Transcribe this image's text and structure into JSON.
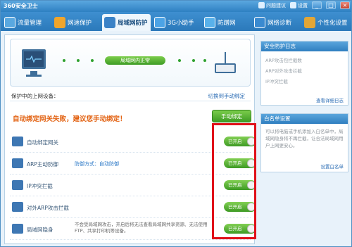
{
  "window": {
    "title": "360安全卫士",
    "feedback": "问题建议",
    "settings": "设置",
    "buttons": [
      "_",
      "□",
      "×"
    ]
  },
  "tabs": [
    {
      "label": "流量管理",
      "icon": "bar-chart-icon",
      "color": "#5aa8e0"
    },
    {
      "label": "网速保护",
      "icon": "speed-icon",
      "color": "#f0a52c"
    },
    {
      "label": "局域网防护",
      "icon": "lan-shield-icon",
      "color": "#3b82c6",
      "active": true
    },
    {
      "label": "3G小助手",
      "icon": "3g-icon",
      "color": "#4ca3e5"
    },
    {
      "label": "防蹭网",
      "icon": "wifi-icon",
      "color": "#59b1ea"
    },
    {
      "label": "网络诊断",
      "icon": "diagnose-icon",
      "color": "#3a8ad0"
    },
    {
      "label": "个性化设置",
      "icon": "puzzle-icon",
      "color": "#e2a637"
    }
  ],
  "status": {
    "text": "局域网内正常",
    "protection_label": "保护中的上网设备：",
    "protection_link": "切换到手动绑定"
  },
  "bind": {
    "warning": "自动绑定网关失败，建议您手动绑定！",
    "button": "手动绑定"
  },
  "features": [
    {
      "name": "自动绑定网关",
      "sub": "",
      "desc": "",
      "toggle": "已开启",
      "icon": "gateway-icon"
    },
    {
      "name": "ARP主动防御",
      "sub": "防御方式：自动防御",
      "desc": "",
      "toggle": "已开启",
      "icon": "arp-shield-icon"
    },
    {
      "name": "IP冲突拦截",
      "sub": "",
      "desc": "",
      "toggle": "已开启",
      "icon": "ip-conflict-icon"
    },
    {
      "name": "对外ARP攻击拦截",
      "sub": "",
      "desc": "",
      "toggle": "已开启",
      "icon": "arp-attack-icon"
    },
    {
      "name": "局域网隐身",
      "sub": "",
      "desc": "不会受局域网攻击，开启后将无法查看局域网共享资源、无法使用FTP、共享打印机等设备。",
      "toggle": "已开启",
      "icon": "stealth-icon"
    }
  ],
  "log": {
    "title": "安全防护日志",
    "lines": [
      "ARP攻击包拦截数",
      "ARP对外攻击拦截",
      "IP冲突拦截"
    ],
    "more": "查看详细日志"
  },
  "whitelist": {
    "title": "白名单设置",
    "text": "可以将电脑或手机添加入白名单中，局域网隐身将不再拦截，让合法局域网用户上网更安心。",
    "link": "设置白名单"
  }
}
